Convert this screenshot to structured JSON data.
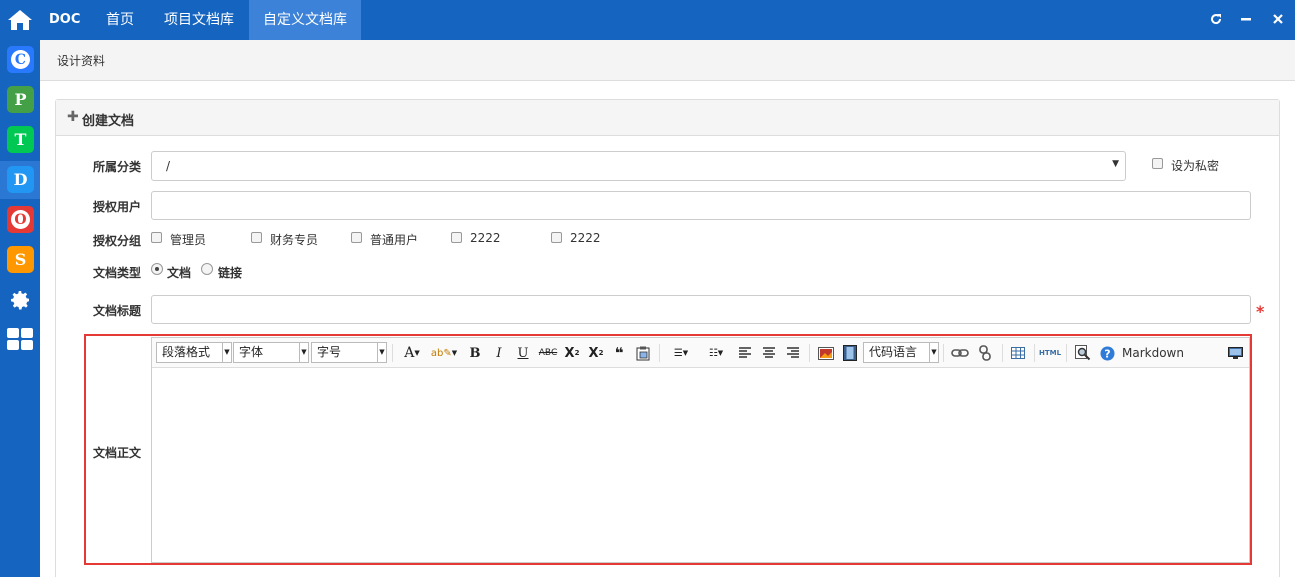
{
  "topbar": {
    "brand": "DOC",
    "tabs": [
      {
        "label": "首页"
      },
      {
        "label": "项目文档库"
      },
      {
        "label": "自定义文档库"
      }
    ]
  },
  "rail": {
    "apps": [
      {
        "letter": "C",
        "color": "#2979ff"
      },
      {
        "letter": "P",
        "color": "#43a047"
      },
      {
        "letter": "T",
        "color": "#00c853"
      },
      {
        "letter": "D",
        "color": "#2196f3"
      },
      {
        "letter": "O",
        "color": "#e53935"
      },
      {
        "letter": "S",
        "color": "#ff9800"
      }
    ]
  },
  "breadcrumb": "设计资料",
  "panel": {
    "title": "创建文档"
  },
  "form": {
    "category_label": "所属分类",
    "category_value": "/",
    "private_label": "设为私密",
    "auth_user_label": "授权用户",
    "auth_group_label": "授权分组",
    "groups": [
      "管理员",
      "财务专员",
      "普通用户",
      "2222",
      "2222"
    ],
    "doc_type_label": "文档类型",
    "doc_types": [
      "文档",
      "链接"
    ],
    "doc_title_label": "文档标题",
    "required_mark": "*",
    "body_label": "文档正文"
  },
  "editor": {
    "selects": [
      "段落格式",
      "字体",
      "字号",
      "代码语言"
    ],
    "markdown_label": "Markdown",
    "html_label": "HTML"
  }
}
